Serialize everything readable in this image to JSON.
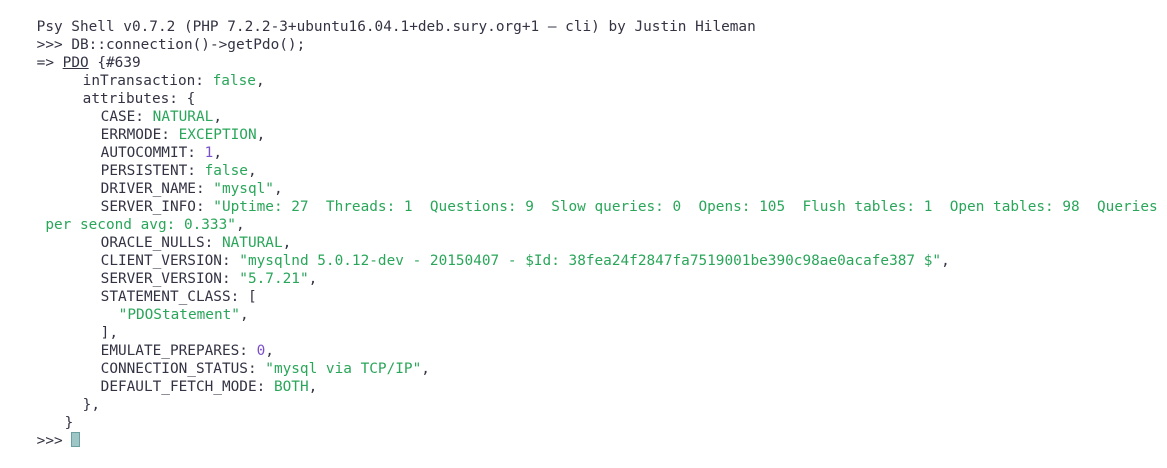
{
  "header": "Psy Shell v0.7.2 (PHP 7.2.2-3+ubuntu16.04.1+deb.sury.org+1 — cli) by Justin Hileman",
  "prompt": ">>>",
  "command": "DB::connection()->getPdo();",
  "result": {
    "arrow": "=>",
    "class_name": "PDO",
    "object_id": "{#639",
    "inTransaction": {
      "key": "inTransaction:",
      "value": "false"
    },
    "attributes_key": "attributes: {",
    "attrs": {
      "case": {
        "key": "CASE:",
        "value": "NATURAL"
      },
      "errmode": {
        "key": "ERRMODE:",
        "value": "EXCEPTION"
      },
      "autocommit": {
        "key": "AUTOCOMMIT:",
        "value": "1"
      },
      "persistent": {
        "key": "PERSISTENT:",
        "value": "false"
      },
      "driver_name": {
        "key": "DRIVER_NAME:",
        "value": "\"mysql\""
      },
      "server_info": {
        "key": "SERVER_INFO:",
        "value_line1": "\"Uptime: 27  Threads: 1  Questions: 9  Slow queries: 0  Opens: 105  Flush tables: 1  Open tables: 98  Queries",
        "value_line2": " per second avg: 0.333\""
      },
      "oracle_nulls": {
        "key": "ORACLE_NULLS:",
        "value": "NATURAL"
      },
      "client_version": {
        "key": "CLIENT_VERSION:",
        "value": "\"mysqlnd 5.0.12-dev - 20150407 - $Id: 38fea24f2847fa7519001be390c98ae0acafe387 $\""
      },
      "server_version": {
        "key": "SERVER_VERSION:",
        "value": "\"5.7.21\""
      },
      "statement_class": {
        "key": "STATEMENT_CLASS: [",
        "item": "\"PDOStatement\"",
        "close": "],"
      },
      "emulate_prepares": {
        "key": "EMULATE_PREPARES:",
        "value": "0"
      },
      "connection_status": {
        "key": "CONNECTION_STATUS:",
        "value": "\"mysql via TCP/IP\""
      },
      "default_fetch_mode": {
        "key": "DEFAULT_FETCH_MODE:",
        "value": "BOTH"
      }
    },
    "attributes_close": "},",
    "object_close": "}"
  },
  "final_prompt": ">>>"
}
